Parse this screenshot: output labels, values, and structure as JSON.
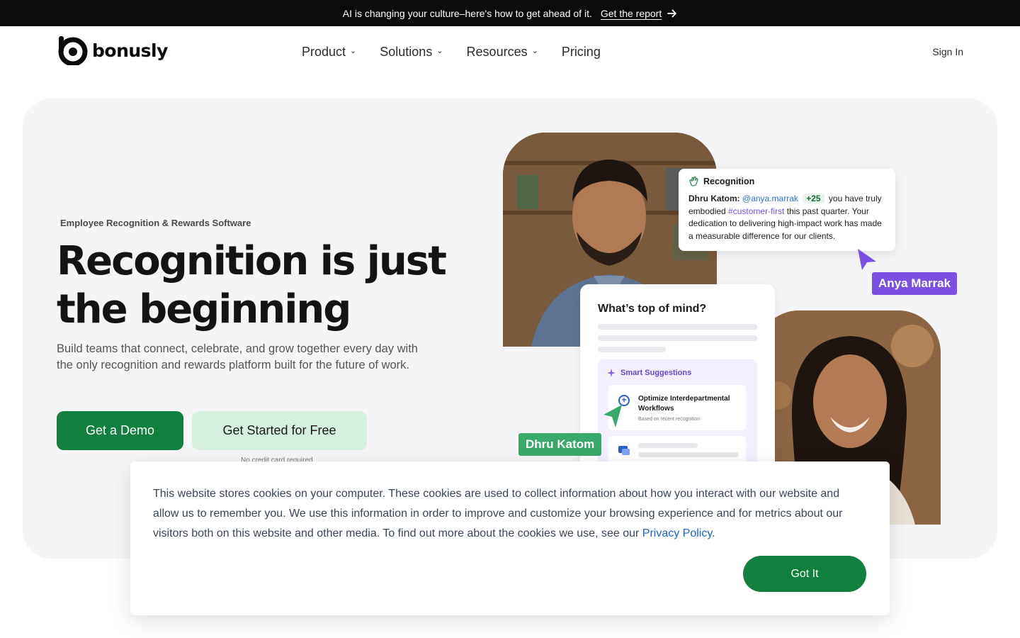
{
  "announcement": {
    "text": "AI is changing your culture–here's how to get ahead of it.",
    "link_label": "Get the report",
    "link_icon": "arrow-right-icon"
  },
  "nav": {
    "brand": "bonusly",
    "items": [
      {
        "label": "Product",
        "has_dropdown": true
      },
      {
        "label": "Solutions",
        "has_dropdown": true
      },
      {
        "label": "Resources",
        "has_dropdown": true
      },
      {
        "label": "Pricing",
        "has_dropdown": false
      }
    ],
    "sign_in": "Sign In"
  },
  "hero": {
    "eyebrow": "Employee Recognition & Rewards Software",
    "headline": "Recognition is just the beginning",
    "subheadline": "Build teams that connect, celebrate, and grow together every day with the only recognition and rewards platform built for the future of work.",
    "primary_cta": "Get a Demo",
    "secondary_cta": "Get Started for Free",
    "no_card_note": "No credit card required"
  },
  "recognition_card": {
    "title": "Recognition",
    "sender": "Dhru Katom:",
    "mention": "@anya.marrak",
    "points": "+25",
    "text_1": " you have truly embodied ",
    "hashtag": "#customer-first",
    "text_2": " this past quarter. Your dedication to delivering high-impact work has made a measurable difference for our clients."
  },
  "labels": {
    "anya": "Anya Marrak",
    "dhru": "Dhru Katom"
  },
  "mind_card": {
    "title": "What’s top of mind?",
    "suggestions_title": "Smart Suggestions",
    "suggestion_title": "Optimize Interdepartmental Workflows",
    "suggestion_subtitle": "Based on recent recognition"
  },
  "cookie": {
    "text": "This website stores cookies on your computer. These cookies are used to collect information about how you interact with our website and allow us to remember you. We use this information in order to improve and customize your browsing experience and for metrics about our visitors both on this website and other media. To find out more about the cookies we use, see our ",
    "link": "Privacy Policy",
    "after_link": ".",
    "button": "Got It"
  },
  "colors": {
    "brand_green": "#11803f",
    "light_green": "#d5f0de",
    "purple": "#7b4fe0",
    "hero_bg": "#f5f5f7"
  }
}
